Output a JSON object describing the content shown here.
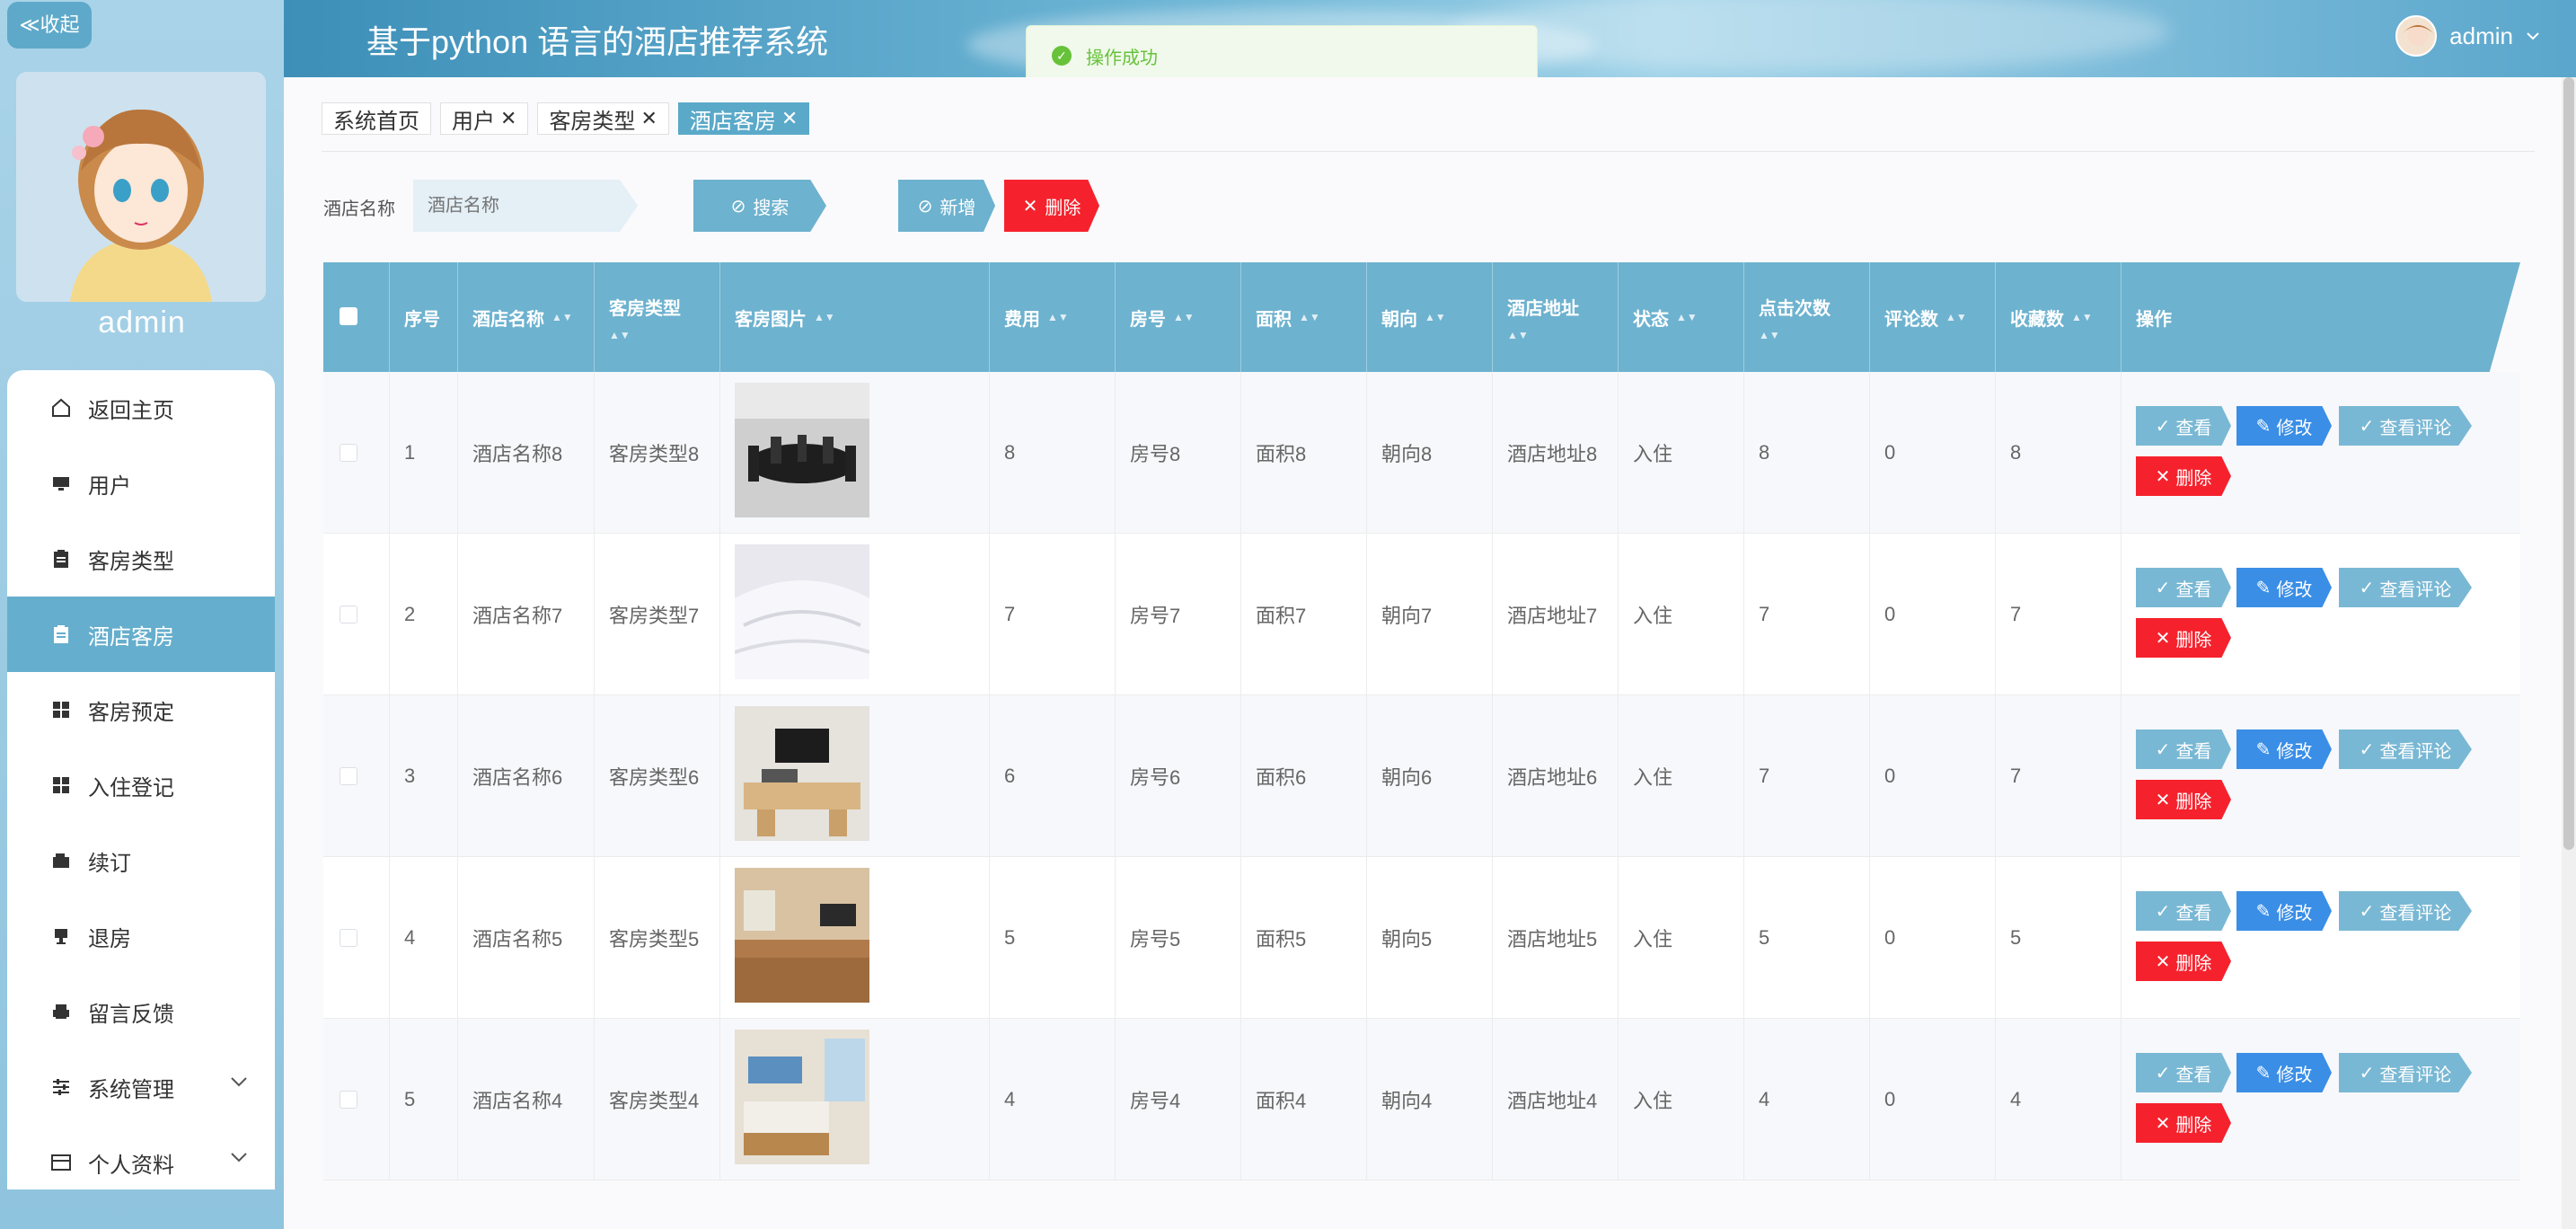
{
  "app": {
    "title": "基于python 语言的酒店推荐系统",
    "collapse_label": "≪收起",
    "username": "admin",
    "header_user": "admin"
  },
  "toast": {
    "message": "操作成功"
  },
  "menu": [
    {
      "label": "返回主页",
      "icon": "home-icon"
    },
    {
      "label": "用户",
      "icon": "monitor-icon"
    },
    {
      "label": "客房类型",
      "icon": "clipboard-icon"
    },
    {
      "label": "酒店客房",
      "icon": "clipboard-icon",
      "active": true
    },
    {
      "label": "客房预定",
      "icon": "grid-icon"
    },
    {
      "label": "入住登记",
      "icon": "grid-icon"
    },
    {
      "label": "续订",
      "icon": "wallet-icon"
    },
    {
      "label": "退房",
      "icon": "cup-icon"
    },
    {
      "label": "留言反馈",
      "icon": "printer-icon"
    },
    {
      "label": "系统管理",
      "icon": "sliders-icon"
    },
    {
      "label": "个人资料",
      "icon": "card-icon"
    }
  ],
  "tabs": [
    {
      "label": "系统首页",
      "closable": false
    },
    {
      "label": "用户",
      "closable": true
    },
    {
      "label": "客房类型",
      "closable": true
    },
    {
      "label": "酒店客房",
      "closable": true,
      "active": true
    }
  ],
  "search": {
    "label": "酒店名称",
    "placeholder": "酒店名称",
    "search_btn": "搜索",
    "add_btn": "新增",
    "delete_btn": "删除"
  },
  "table": {
    "headers": [
      "序号",
      "酒店名称",
      "客房类型",
      "客房图片",
      "费用",
      "房号",
      "面积",
      "朝向",
      "酒店地址",
      "状态",
      "点击次数",
      "评论数",
      "收藏数",
      "操作"
    ],
    "ops": {
      "view": "查看",
      "edit": "修改",
      "review": "查看评论",
      "delete": "删除"
    },
    "rows": [
      {
        "idx": "1",
        "name": "酒店名称8",
        "type": "客房类型8",
        "img": "dining-table",
        "fee": "8",
        "room": "房号8",
        "area": "面积8",
        "dir": "朝向8",
        "addr": "酒店地址8",
        "status": "入住",
        "clicks": "8",
        "comments": "0",
        "favs": "8"
      },
      {
        "idx": "2",
        "name": "酒店名称7",
        "type": "客房类型7",
        "img": "white-bed",
        "fee": "7",
        "room": "房号7",
        "area": "面积7",
        "dir": "朝向7",
        "addr": "酒店地址7",
        "status": "入住",
        "clicks": "7",
        "comments": "0",
        "favs": "7"
      },
      {
        "idx": "3",
        "name": "酒店名称6",
        "type": "客房类型6",
        "img": "tv-room",
        "fee": "6",
        "room": "房号6",
        "area": "面积6",
        "dir": "朝向6",
        "addr": "酒店地址6",
        "status": "入住",
        "clicks": "7",
        "comments": "0",
        "favs": "7"
      },
      {
        "idx": "4",
        "name": "酒店名称5",
        "type": "客房类型5",
        "img": "wood-room",
        "fee": "5",
        "room": "房号5",
        "area": "面积5",
        "dir": "朝向5",
        "addr": "酒店地址5",
        "status": "入住",
        "clicks": "5",
        "comments": "0",
        "favs": "5"
      },
      {
        "idx": "5",
        "name": "酒店名称4",
        "type": "客房类型4",
        "img": "bright-room",
        "fee": "4",
        "room": "房号4",
        "area": "面积4",
        "dir": "朝向4",
        "addr": "酒店地址4",
        "status": "入住",
        "clicks": "4",
        "comments": "0",
        "favs": "4"
      }
    ]
  }
}
